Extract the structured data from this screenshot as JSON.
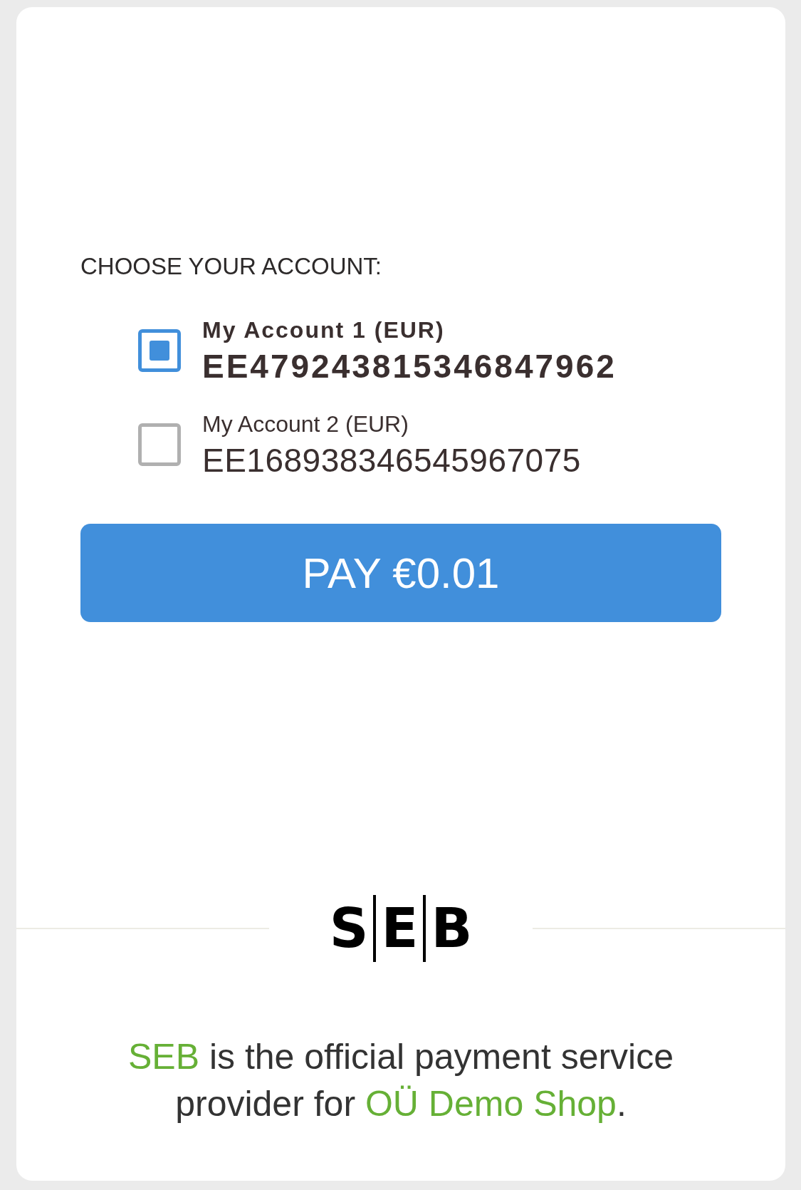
{
  "prompt": "CHOOSE YOUR ACCOUNT:",
  "accounts": [
    {
      "name": "My Account 1 (EUR)",
      "iban": "EE479243815346847962",
      "selected": true
    },
    {
      "name": "My Account 2 (EUR)",
      "iban": "EE168938346545967075",
      "selected": false
    }
  ],
  "pay_button": "PAY €0.01",
  "logo": [
    "S",
    "E",
    "B"
  ],
  "footer": [
    {
      "text": "SEB",
      "highlight": true
    },
    {
      "text": " is the official payment service provider for ",
      "highlight": false
    },
    {
      "text": "OÜ Demo Shop",
      "highlight": true
    },
    {
      "text": ".",
      "highlight": false
    }
  ]
}
